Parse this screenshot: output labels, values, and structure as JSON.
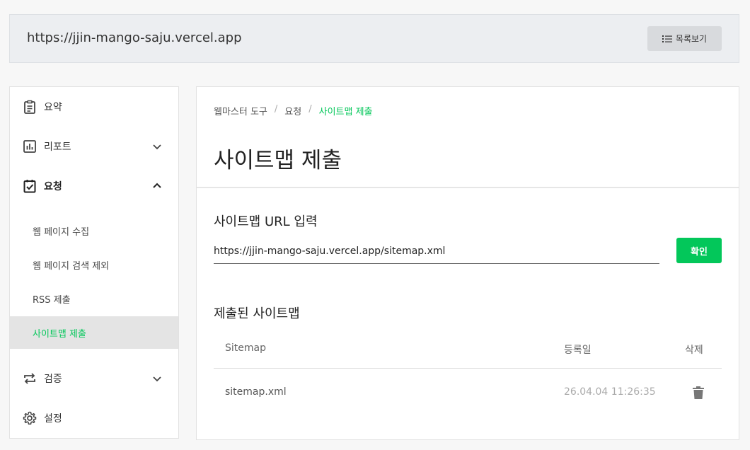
{
  "header": {
    "site_url": "https://jjin-mango-saju.vercel.app",
    "list_button_label": "목록보기"
  },
  "sidebar": {
    "items": [
      {
        "label": "요약",
        "icon": "clipboard-icon"
      },
      {
        "label": "리포트",
        "icon": "bar-chart-icon",
        "expanded": false
      },
      {
        "label": "요청",
        "icon": "clipboard-check-icon",
        "expanded": true
      },
      {
        "label": "검증",
        "icon": "repeat-icon",
        "expanded": false
      },
      {
        "label": "설정",
        "icon": "gear-icon"
      }
    ],
    "request_subitems": [
      {
        "label": "웹 페이지 수집"
      },
      {
        "label": "웹 페이지 검색 제외"
      },
      {
        "label": "RSS 제출"
      },
      {
        "label": "사이트맵 제출",
        "active": true
      }
    ]
  },
  "breadcrumb": [
    "웹마스터 도구",
    "요청",
    "사이트맵 제출"
  ],
  "page_title": "사이트맵 제출",
  "sitemap_input": {
    "label": "사이트맵 URL 입력",
    "value": "https://jjin-mango-saju.vercel.app/sitemap.xml",
    "button_label": "확인"
  },
  "submitted": {
    "title": "제출된 사이트맵",
    "columns": [
      "Sitemap",
      "등록일",
      "삭제"
    ],
    "rows": [
      {
        "sitemap": "sitemap.xml",
        "date": "26.04.04 11:26:35"
      }
    ]
  },
  "colors": {
    "accent": "#03c75a",
    "active_bg": "#e4e4e4"
  }
}
